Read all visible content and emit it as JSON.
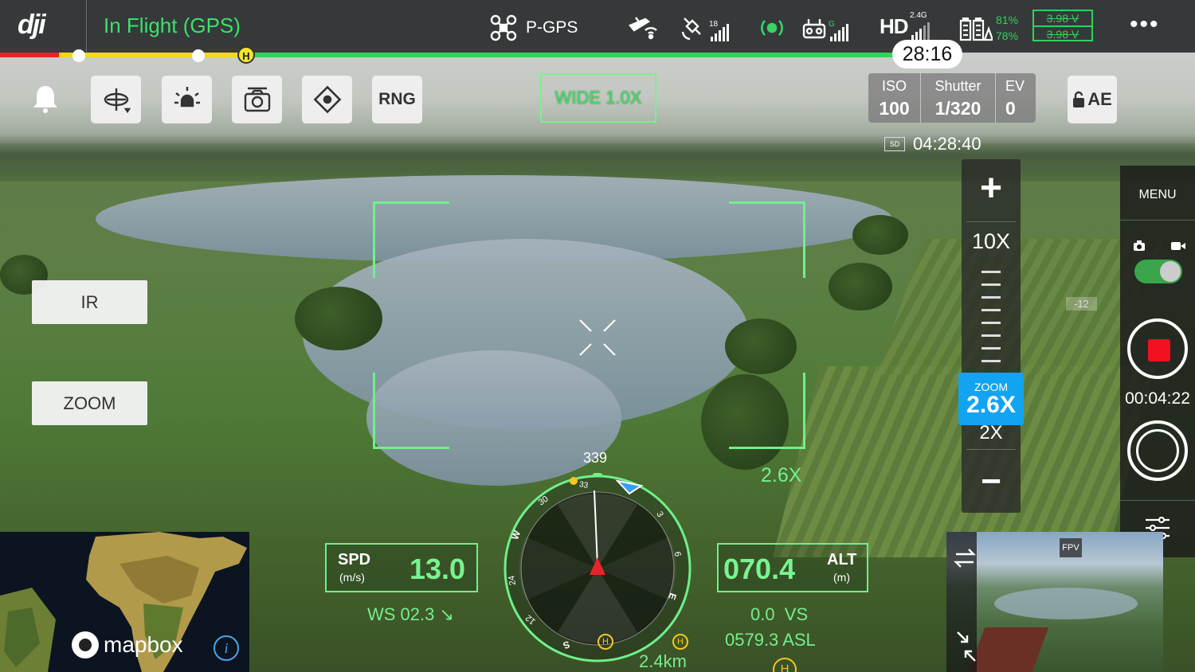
{
  "app": {
    "logo": "dji"
  },
  "status_bar": {
    "flight_status": "In Flight (GPS)",
    "flight_mode": "P-GPS",
    "gps_satellites": "18",
    "rc_band": "G",
    "video_link": "HD",
    "video_band": "2.4G",
    "battery_pct_1": "81%",
    "battery_pct_2": "78%",
    "cell_voltage_1": "3.98 V",
    "cell_voltage_2": "3.98 V",
    "status_color": "#39e36a"
  },
  "flight_time": {
    "remaining": "28:16",
    "home_marker": "H",
    "colors": {
      "critical": "#e8232b",
      "low": "#f5d61b",
      "safe": "#33d35a"
    }
  },
  "toolbar": {
    "rng_label": "RNG",
    "lens_label": "WIDE  1.0X",
    "ae_label": "AE"
  },
  "exposure": {
    "iso_label": "ISO",
    "iso_value": "100",
    "shutter_label": "Shutter",
    "shutter_value": "1/320",
    "ev_label": "EV",
    "ev_value": "0"
  },
  "storage": {
    "sd_label": "SD",
    "remaining_time": "04:28:40"
  },
  "zoom": {
    "max_label": "10X",
    "min_label": "2X",
    "current_caption": "ZOOM",
    "current_value": "2.6X",
    "overlay_value": "2.6X",
    "accent_color": "#12a4f0"
  },
  "side_buttons": {
    "ir_label": "IR",
    "zoom_label": "ZOOM"
  },
  "right_rail": {
    "menu_label": "MENU",
    "record_time": "00:04:22",
    "record_color": "#f20f1f"
  },
  "telemetry": {
    "speed_label": "SPD",
    "speed_unit": "(m/s)",
    "speed_value": "13.0",
    "wind_speed": "WS 02.3 ↘",
    "alt_label": "ALT",
    "alt_unit": "(m)",
    "alt_value": "070.4",
    "vertical_speed": "0.0  VS",
    "altitude_asl": "0579.3 ASL",
    "home_distance": "2.4km"
  },
  "compass": {
    "heading": "339",
    "labels": {
      "n_tick": "33",
      "nw": "30",
      "w": "W",
      "sw": "24",
      "s": "S",
      "se": "12",
      "e": "E",
      "ne_a": "6",
      "ne_b": "3",
      "home": "H"
    }
  },
  "map": {
    "attribution": "mapbox",
    "info": "i"
  },
  "fpv": {
    "label": "FPV"
  },
  "scene": {
    "grid_marker": "-12"
  }
}
